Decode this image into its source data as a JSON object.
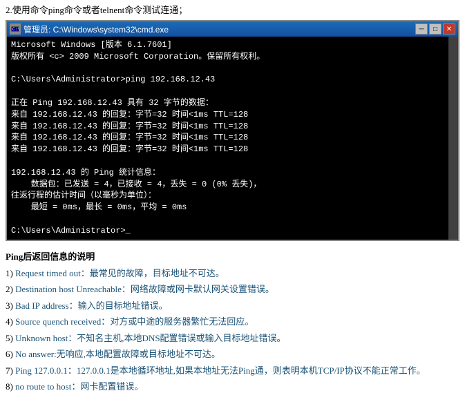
{
  "top_instruction": "2.使用命令ping命令或者telnent命令测试连通；",
  "cmd": {
    "title": "管理员: C:\\Windows\\system32\\cmd.exe",
    "lines": [
      "Microsoft Windows [版本 6.1.7601]",
      "版权所有 <c> 2009 Microsoft Corporation。保留所有权利。",
      "",
      "C:\\Users\\Administrator>ping 192.168.12.43",
      "",
      "正在 Ping 192.168.12.43 具有 32 字节的数据：",
      "来自 192.168.12.43 的回复：字节=32 时间<1ms TTL=128",
      "来自 192.168.12.43 的回复：字节=32 时间<1ms TTL=128",
      "来自 192.168.12.43 的回复：字节=32 时间<1ms TTL=128",
      "来自 192.168.12.43 的回复：字节=32 时间<1ms TTL=128",
      "",
      "192.168.12.43 的 Ping 统计信息：",
      "    数据包：已发送 = 4，已接收 = 4，丢失 = 0 (0% 丢失)，",
      "往返行程的估计时间（以毫秒为单位）：",
      "    最短 = 0ms，最长 = 0ms，平均 = 0ms",
      "",
      "C:\\Users\\Administrator>_"
    ],
    "controls": {
      "minimize": "─",
      "maximize": "□",
      "close": "✕"
    }
  },
  "section_title": "Ping后返回信息的说明",
  "items": [
    {
      "num": "1)",
      "label": "Request timed out：",
      "desc": "最常见的故障，目标地址不可达。"
    },
    {
      "num": "2)",
      "label": "Destination host Unreachable：",
      "desc": "网络故障或网卡默认网关设置错误。"
    },
    {
      "num": "3)",
      "label": "Bad IP address：",
      "desc": "输入的目标地址错误。"
    },
    {
      "num": "4)",
      "label": "Source quench received：",
      "desc": "对方或中途的服务器繁忙无法回应。"
    },
    {
      "num": "5)",
      "label": "Unknown host：",
      "desc": "不知名主机,本地DNS配置错误或输入目标地址错误。"
    },
    {
      "num": "6)",
      "label": "No answer:",
      "desc": "无响应,本地配置故障或目标地址不可达。"
    },
    {
      "num": "7)",
      "label": "Ping 127.0.0.1：",
      "desc": "127.0.0.1是本地循环地址,如果本地址无法Ping通，则表明本机TCP/IP协议不能正常工作。"
    },
    {
      "num": "8)",
      "label": "no route to host：",
      "desc": "网卡配置错误。"
    }
  ]
}
